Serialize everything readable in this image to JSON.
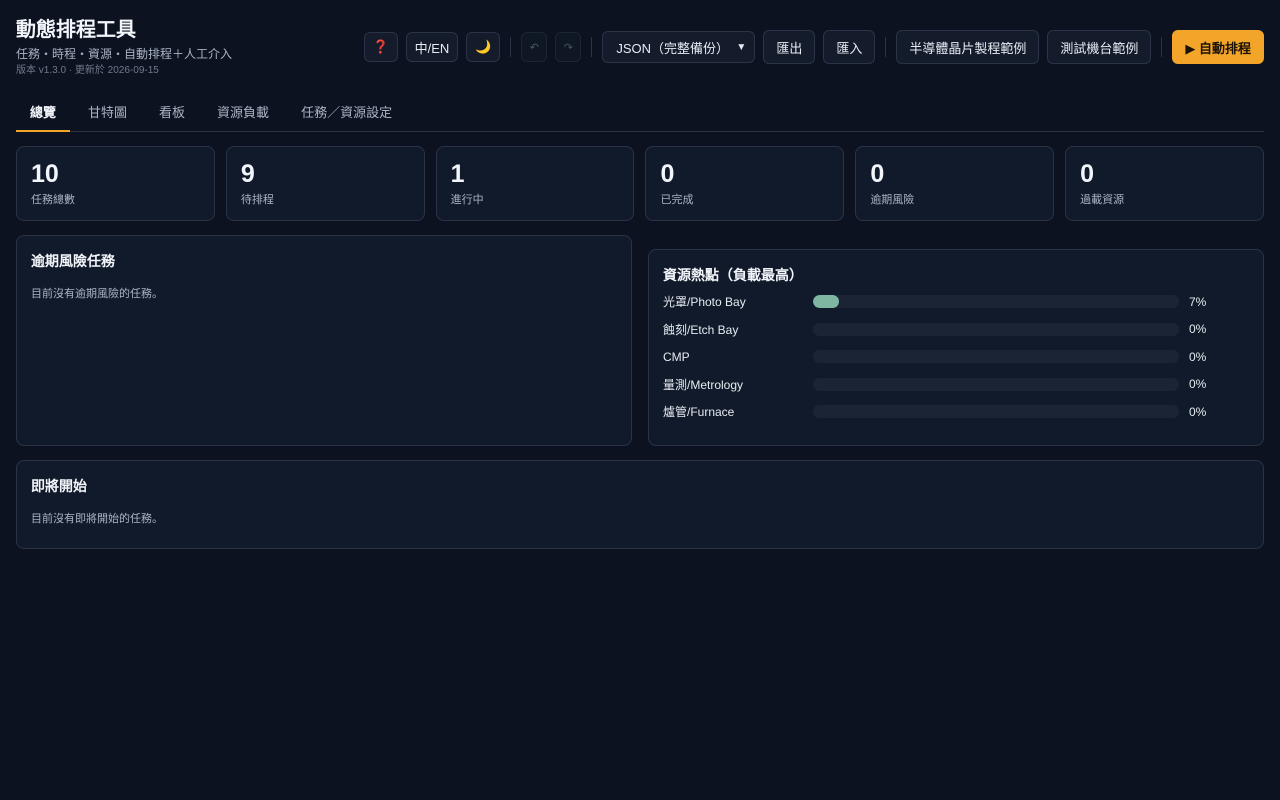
{
  "header": {
    "title": "動態排程工具",
    "subtitle": "任務・時程・資源・自動排程＋人工介入",
    "version": "版本 v1.3.0 · 更新於 2026-09-15"
  },
  "toolbar": {
    "help_icon": "❓",
    "lang_label": "中/EN",
    "theme_icon": "🌙",
    "undo_icon": "↶",
    "redo_icon": "↷",
    "format_select": "JSON（完整備份）",
    "export_label": "匯出",
    "import_label": "匯入",
    "example_semi": "半導體晶片製程範例",
    "example_test": "測試機台範例",
    "auto_schedule": "▶ 自動排程"
  },
  "tabs": [
    {
      "label": "總覽",
      "active": true
    },
    {
      "label": "甘特圖",
      "active": false
    },
    {
      "label": "看板",
      "active": false
    },
    {
      "label": "資源負載",
      "active": false
    },
    {
      "label": "任務／資源設定",
      "active": false
    }
  ],
  "stats": [
    {
      "value": "10",
      "label": "任務總數"
    },
    {
      "value": "9",
      "label": "待排程"
    },
    {
      "value": "1",
      "label": "進行中"
    },
    {
      "value": "0",
      "label": "已完成"
    },
    {
      "value": "0",
      "label": "逾期風險"
    },
    {
      "value": "0",
      "label": "過載資源"
    }
  ],
  "overdue": {
    "title": "逾期風險任務",
    "empty": "目前沒有逾期風險的任務。"
  },
  "hotspots": {
    "title": "資源熱點（負載最高）",
    "bar_color": "#7fb6a2",
    "items": [
      {
        "name": "光罩/Photo Bay",
        "pct_label": "7%",
        "value": 0.07
      },
      {
        "name": "蝕刻/Etch Bay",
        "pct_label": "0%",
        "value": 0
      },
      {
        "name": "CMP",
        "pct_label": "0%",
        "value": 0
      },
      {
        "name": "量測/Metrology",
        "pct_label": "0%",
        "value": 0
      },
      {
        "name": "爐管/Furnace",
        "pct_label": "0%",
        "value": 0
      }
    ]
  },
  "upcoming": {
    "title": "即將開始",
    "empty": "目前沒有即將開始的任務。"
  },
  "colors": {
    "accent": "#f3a52a",
    "background": "#0c1220",
    "card": "#111a2a"
  }
}
